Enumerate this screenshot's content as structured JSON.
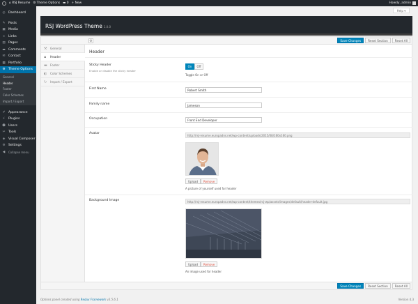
{
  "admin_bar": {
    "site_name": "RSJ Resume",
    "theme_options": "Theme Options",
    "comments": "0",
    "new_label": "New",
    "howdy": "Howdy, admin"
  },
  "sidebar": {
    "items_top": [
      {
        "label": "Dashboard",
        "icon": "dashboard-icon",
        "glyph": "◎"
      }
    ],
    "items": [
      {
        "label": "Posts",
        "icon": "pin-icon",
        "glyph": "✎"
      },
      {
        "label": "Media",
        "icon": "media-icon",
        "glyph": "▣"
      },
      {
        "label": "Links",
        "icon": "link-icon",
        "glyph": "∞"
      },
      {
        "label": "Pages",
        "icon": "page-icon",
        "glyph": "▤"
      },
      {
        "label": "Comments",
        "icon": "comment-icon",
        "glyph": "▬"
      },
      {
        "label": "Contact",
        "icon": "mail-icon",
        "glyph": "✉"
      },
      {
        "label": "Portfolio",
        "icon": "portfolio-icon",
        "glyph": "▦"
      },
      {
        "label": "Theme Options",
        "icon": "gear-icon",
        "glyph": "⚙"
      }
    ],
    "submenu": [
      "General",
      "Header",
      "Footer",
      "Color Schemes",
      "Import / Export"
    ],
    "items_bottom": [
      {
        "label": "Appearance",
        "icon": "brush-icon",
        "glyph": "✐"
      },
      {
        "label": "Plugins",
        "icon": "plugin-icon",
        "glyph": "⚡"
      },
      {
        "label": "Users",
        "icon": "user-icon",
        "glyph": "☻"
      },
      {
        "label": "Tools",
        "icon": "wrench-icon",
        "glyph": "✂"
      },
      {
        "label": "Visual Composer",
        "icon": "composer-icon",
        "glyph": "◈"
      },
      {
        "label": "Settings",
        "icon": "settings-icon",
        "glyph": "⚙"
      },
      {
        "label": "Collapse menu",
        "icon": "collapse-icon",
        "glyph": "◀"
      }
    ]
  },
  "help_label": "Help ▾",
  "header": {
    "title": "RSJ WordPress Theme",
    "version": "1.0.0"
  },
  "actions": {
    "save": "Save Changes",
    "reset_section": "Reset Section",
    "reset_all": "Reset All"
  },
  "tabs": [
    {
      "label": "General",
      "icon": "wrench-icon",
      "glyph": "⚒"
    },
    {
      "label": "Header",
      "icon": "home-icon",
      "glyph": "⌂"
    },
    {
      "label": "Footer",
      "icon": "footer-icon",
      "glyph": "▬"
    },
    {
      "label": "Color Schemes",
      "icon": "color-icon",
      "glyph": "◐"
    },
    {
      "label": "Import / Export",
      "icon": "refresh-icon",
      "glyph": "↻"
    }
  ],
  "panel": {
    "title": "Header",
    "sticky": {
      "label": "Sticky Header",
      "desc": "Enable or disable the sticky header",
      "on": "On",
      "off": "Off",
      "toggle_caption": "Toggle On or Off"
    },
    "first_name": {
      "label": "First Name",
      "value": "Robert Smith"
    },
    "family_name": {
      "label": "Family name",
      "value": "Jameson"
    },
    "occupation": {
      "label": "Occupation",
      "value": "Front End Developer"
    },
    "avatar": {
      "label": "Avatar",
      "url": "http://rsj-resume.europadns.net/wp-content/uploads/2015/08/160x160.png",
      "upload": "Upload",
      "remove": "Remove",
      "caption": "A picture of yourself used for header"
    },
    "background": {
      "label": "Background Image",
      "url": "http://rsj-resume.europadns.net/wp-content/themes/rsj-wp/assets/images/default/header-default.jpg",
      "upload": "Upload",
      "remove": "Remove",
      "caption": "An image used for header"
    }
  },
  "footer": {
    "prefix": "Options panel created using ",
    "link": "Redux Framework",
    "suffix": " v3.5.6.1",
    "version": "Version 4.3"
  },
  "colors": {
    "admin_dark": "#23282d",
    "accent": "#0073aa",
    "primary_button": "#0085ba"
  }
}
